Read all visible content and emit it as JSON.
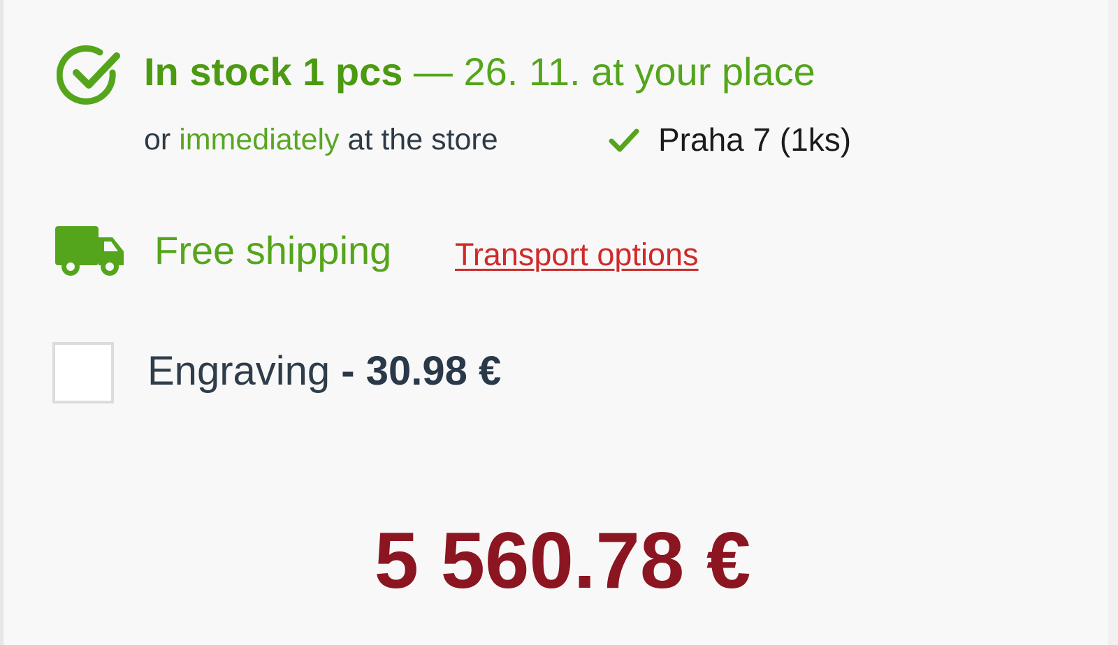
{
  "availability": {
    "stock_bold": "In stock 1 pcs",
    "stock_rest": " — 26. 11. at your place",
    "store_prefix": "or ",
    "store_highlight": "immediately",
    "store_suffix": " at the store",
    "store_name": "Praha 7 (1ks)"
  },
  "shipping": {
    "label": "Free shipping",
    "link_label": "Transport options"
  },
  "engraving": {
    "label": "Engraving",
    "price": " - 30.98 €",
    "checked": false
  },
  "total": {
    "price": "5 560.78 €"
  },
  "icons": {
    "stock": "check-circle-icon",
    "store": "check-icon",
    "shipping": "truck-icon"
  },
  "colors": {
    "green": "#55a51c",
    "link_red": "#d02a2a",
    "price_red": "#8c1522",
    "text_dark": "#2f3d4b"
  }
}
